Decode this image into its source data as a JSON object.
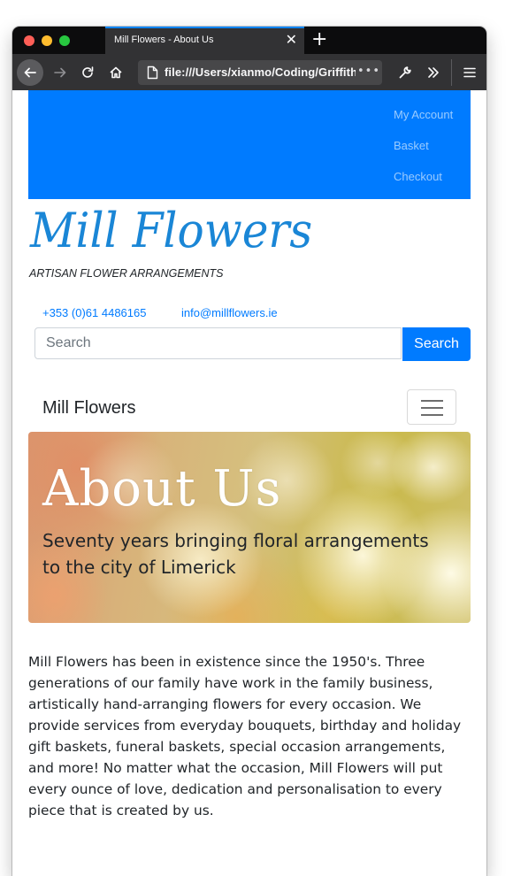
{
  "browser": {
    "tab_title": "Mill Flowers - About Us",
    "tab_close": "✕",
    "new_tab": "+",
    "url": "file:///Users/xianmo/Coding/Griffith",
    "url_more": "•••"
  },
  "page": {
    "top_links": [
      "My Account",
      "Basket",
      "Checkout"
    ],
    "brand_logo": "Mill Flowers",
    "tagline": "ARTISAN FLOWER ARRANGEMENTS",
    "phone": "+353 (0)61 4486165",
    "email": "info@millflowers.ie",
    "search": {
      "placeholder": "Search",
      "button": "Search"
    },
    "navbar_brand": "Mill Flowers",
    "hero": {
      "title": "About Us",
      "subtitle": "Seventy years bringing floral arrangements to the city of Limerick"
    },
    "about_text": "Mill Flowers has been in existence since the 1950's. Three generations of our family have work in the family business, artistically hand-arranging flowers for every occasion. We provide services from everyday bouquets, birthday and holiday gift baskets, funeral baskets, special occasion arrangements, and more! No matter what the occasion, Mill Flowers will put every ounce of love, dedication and personalisation to every piece that is created by us."
  },
  "colors": {
    "primary": "#007bff",
    "logo": "#1a86d6",
    "titlebar": "#0c0c0d",
    "toolbar": "#323234"
  },
  "icons": [
    "back-arrow-icon",
    "forward-arrow-icon",
    "reload-icon",
    "home-icon",
    "page-icon",
    "wrench-icon",
    "overflow-chevron-icon",
    "hamburger-menu-icon"
  ]
}
